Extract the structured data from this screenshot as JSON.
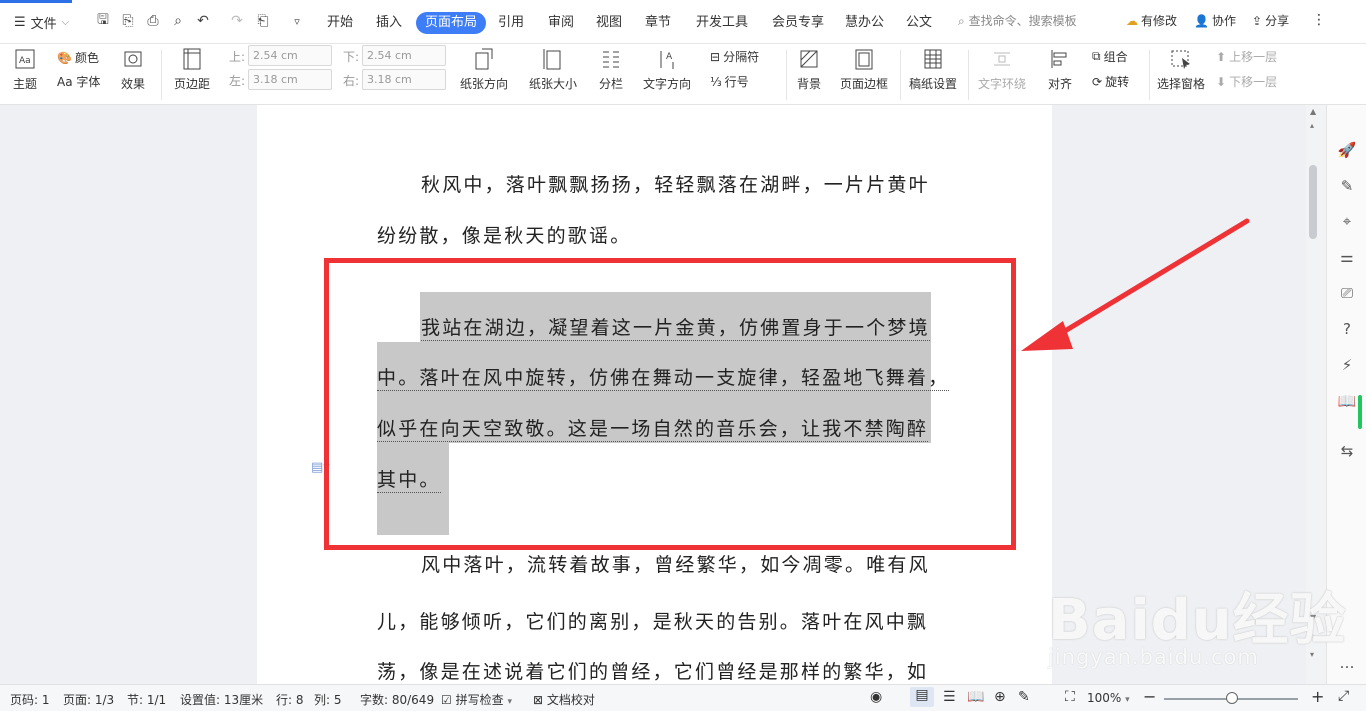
{
  "titlebar": {
    "file_label": "文件",
    "tabs": [
      "开始",
      "插入",
      "页面布局",
      "引用",
      "审阅",
      "视图",
      "章节",
      "开发工具",
      "会员专享",
      "慧办公",
      "公文"
    ],
    "active_tab": "页面布局",
    "search_placeholder": "查找命令、搜索模板",
    "actions": [
      "有修改",
      "协作",
      "分享"
    ]
  },
  "ribbon": {
    "theme": "主题",
    "colors": "颜色",
    "font": "Aa 字体",
    "effects": "效果",
    "margins": "页边距",
    "margin_top_label": "上:",
    "margin_top": "2.54 cm",
    "margin_bottom_label": "下:",
    "margin_bottom": "2.54 cm",
    "margin_left_label": "左:",
    "margin_left": "3.18 cm",
    "margin_right_label": "右:",
    "margin_right": "3.18 cm",
    "orientation": "纸张方向",
    "size": "纸张大小",
    "columns": "分栏",
    "text_direction": "文字方向",
    "breaks": "分隔符",
    "line_numbers": "行号",
    "background": "背景",
    "page_border": "页面边框",
    "manuscript": "稿纸设置",
    "text_wrap": "文字环绕",
    "align": "对齐",
    "group": "组合",
    "rotate": "旋转",
    "selection_pane": "选择窗格",
    "bring_forward": "上移一层",
    "send_backward": "下移一层"
  },
  "document": {
    "para1_line1": "秋风中，落叶飘飘扬扬，轻轻飘落在湖畔，一片片黄叶",
    "para1_line2": "纷纷散，像是秋天的歌谣。",
    "para2_line1": "我站在湖边，凝望着这一片金黄，仿佛置身于一个梦境",
    "para2_line2": "中。落叶在风中旋转，仿佛在舞动一支旋律，轻盈地飞舞着，",
    "para2_line3": "似乎在向天空致敬。这是一场自然的音乐会，让我不禁陶醉",
    "para2_line4": "其中。",
    "para3_line1": "风中落叶，流转着故事，曾经繁华，如今凋零。唯有风",
    "para3_line2": "儿，能够倾听，它们的离别，是秋天的告别。落叶在风中飘",
    "para3_line3": "荡，像是在述说着它们的曾经，它们曾经是那样的繁华，如"
  },
  "statusbar": {
    "page_num": "页码: 1",
    "page_count": "页面: 1/3",
    "section": "节: 1/1",
    "setting": "设置值: 13厘米",
    "row": "行: 8",
    "col": "列: 5",
    "word_count": "字数: 80/649",
    "spell_check": "拼写检查",
    "doc_check": "文档校对",
    "zoom": "100%"
  },
  "watermark": {
    "logo": "Baidu经验",
    "url": "jingyan.baidu.com"
  },
  "colors": {
    "accent": "#3d7df5",
    "highlight": "#c8c8c8",
    "annotation": "#ee3236"
  }
}
